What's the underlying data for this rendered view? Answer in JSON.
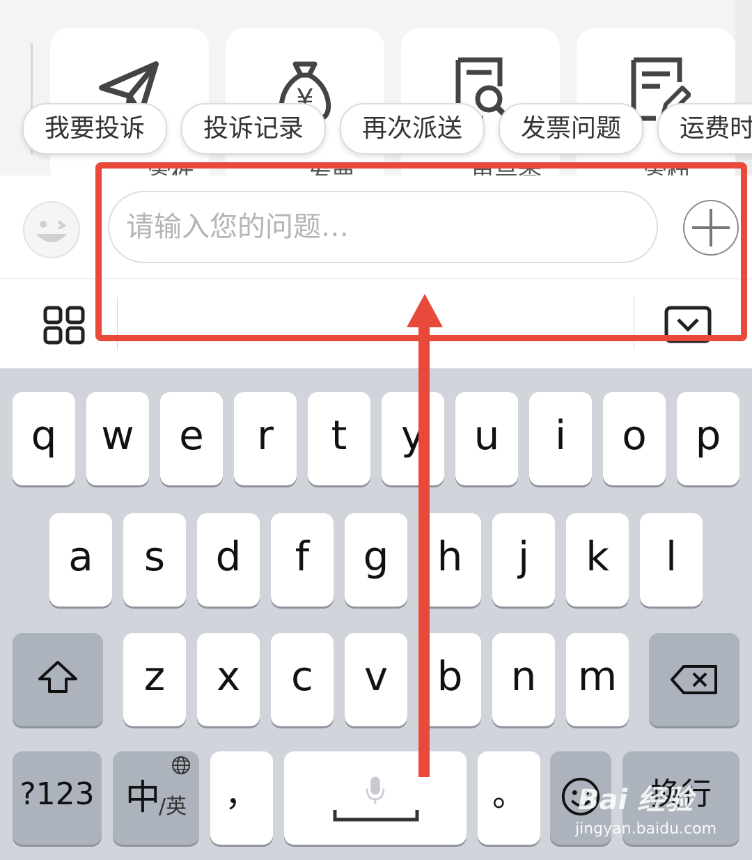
{
  "cards": [
    {
      "icon": "paper-plane-icon",
      "label": "寄件"
    },
    {
      "icon": "money-bag-icon",
      "label": "发票"
    },
    {
      "icon": "search-document-icon",
      "label": "单号查"
    },
    {
      "icon": "edit-document-icon",
      "label": "寄快"
    }
  ],
  "quick_replies": [
    "我要投诉",
    "投诉记录",
    "再次派送",
    "发票问题",
    "运费时"
  ],
  "input": {
    "placeholder": "请输入您的问题…",
    "value": "",
    "emoji_icon": "smiley-icon",
    "plus_icon": "plus-icon"
  },
  "toolbar": {
    "grid_icon": "grid-icon",
    "hide_keyboard_icon": "keyboard-hide-icon"
  },
  "keyboard": {
    "row1": [
      "q",
      "w",
      "e",
      "r",
      "t",
      "y",
      "u",
      "i",
      "o",
      "p"
    ],
    "row2": [
      "a",
      "s",
      "d",
      "f",
      "g",
      "h",
      "j",
      "k",
      "l"
    ],
    "row3": [
      "z",
      "x",
      "c",
      "v",
      "b",
      "n",
      "m"
    ],
    "shift_icon": "shift-icon",
    "delete_icon": "delete-icon",
    "numbers_label": "?123",
    "lang_main": "中",
    "lang_sub": "/英",
    "globe_icon": "globe-icon",
    "comma_label": "，",
    "space_mic_icon": "mic-icon",
    "period_label": "。",
    "emoji_icon": "emoji-key-icon",
    "return_label": "换行"
  },
  "annotation": {
    "color": "#e8493a"
  },
  "watermark": {
    "logo": "Bai 经验",
    "url": "jingyan.baidu.com"
  }
}
